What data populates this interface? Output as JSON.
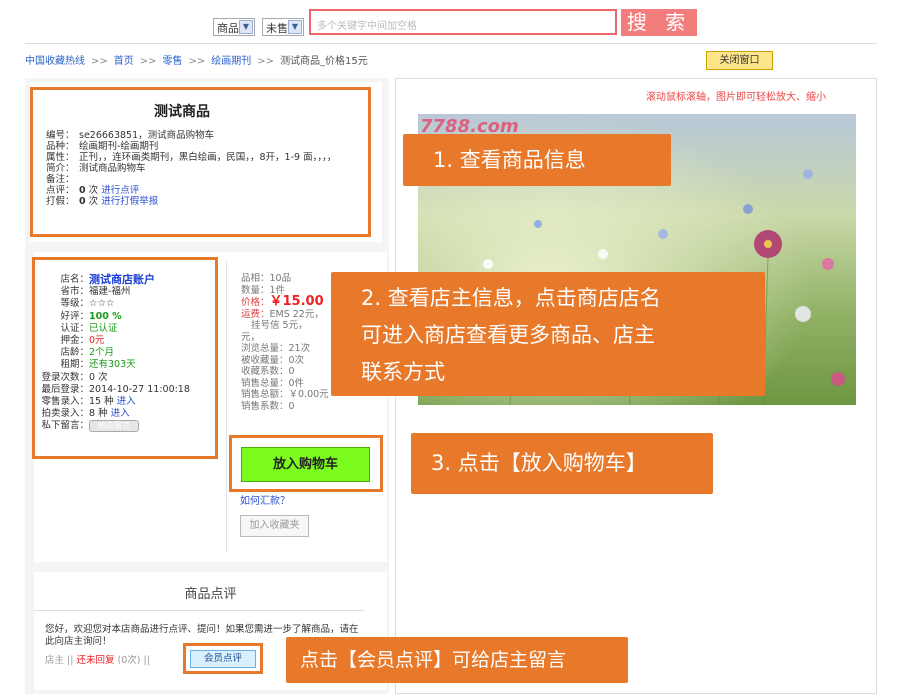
{
  "search": {
    "type_select": "商品",
    "status_select": "未售",
    "placeholder": "多个关键字中间加空格",
    "button_label": "搜 索"
  },
  "breadcrumb": {
    "items": [
      "中国收藏热线",
      "首页",
      "零售",
      "绘画期刊"
    ],
    "current": "测试商品_价格15元",
    "separator": ">>"
  },
  "close_window_label": "关闭窗口",
  "product": {
    "title": "测试商品",
    "rows": [
      {
        "key": "编号：",
        "value": "se26663851，测试商品购物车"
      },
      {
        "key": "品种：",
        "value": "绘画期刊-绘画期刊"
      },
      {
        "key": "属性：",
        "value": "正刊，，连环画类期刊，黑白绘画，民国，，8开，1-9 面，，，，"
      },
      {
        "key": "简介：",
        "value": "测试商品购物车"
      },
      {
        "key": "备注：",
        "value": ""
      }
    ],
    "review_count_label": "点评：",
    "review_count": "0",
    "review_unit": "次",
    "review_link": "进行点评",
    "fake_count_label": "打假：",
    "fake_count": "0",
    "fake_unit": "次",
    "fake_link": "进行打假举报"
  },
  "shop": {
    "name_key": "店名：",
    "name": "测试商店账户",
    "rows": [
      {
        "key": "省市：",
        "value": "福建-福州",
        "tone": "normal"
      },
      {
        "key": "等级：",
        "value": "☆☆☆",
        "tone": "normal"
      },
      {
        "key": "好评：",
        "value": "100 %",
        "tone": "green-bold"
      },
      {
        "key": "认证：",
        "value": "已认证",
        "tone": "green"
      },
      {
        "key": "押金：",
        "value": "0元",
        "tone": "red"
      },
      {
        "key": "店龄：",
        "value": "2个月",
        "tone": "green"
      },
      {
        "key": "租期：",
        "value": "还有303天",
        "tone": "green"
      },
      {
        "key": "登录次数：",
        "value": "0 次",
        "tone": "normal"
      },
      {
        "key": "最后登录：",
        "value": "2014-10-27 11:00:18",
        "tone": "normal"
      }
    ],
    "retail_key": "零售录入：",
    "retail_count": "15 种",
    "retail_link": "进入",
    "auction_key": "拍卖录入：",
    "auction_count": "8 种",
    "auction_link": "进入",
    "msg_key": "私下留言：",
    "msg_button": "给店留言"
  },
  "stats": {
    "rows_top": [
      {
        "key": "品相：",
        "value": "10品"
      },
      {
        "key": "数量：",
        "value": "1件"
      }
    ],
    "price_key": "价格：",
    "price": "￥15.00",
    "shipping_key": "运费：",
    "shipping_lines": [
      "EMS 22元，",
      "挂号信 5元，",
      "元，"
    ],
    "rows_bottom": [
      {
        "key": "浏览总量：",
        "value": "21次"
      },
      {
        "key": "被收藏量：",
        "value": "0次"
      },
      {
        "key": "收藏系数：",
        "value": "0"
      },
      {
        "key": "销售总量：",
        "value": "0件"
      },
      {
        "key": "销售总额：",
        "value": "￥0.00元"
      },
      {
        "key": "销售系数：",
        "value": "0"
      }
    ]
  },
  "cart_button": "放入购物车",
  "how_to_pay": "如何汇款？",
  "add_favorite": "加入收藏夹",
  "review": {
    "title": "商品点评",
    "text": "您好，欢迎您对本店商品进行点评、提问！如果您需进一步了解商品，请在此向店主询问！",
    "owner": "店主",
    "sep": "||",
    "no_reply": "还未回复",
    "count": "(0次)",
    "member_button": "会员点评"
  },
  "zoom_hint": "滚动鼠标滚轴，图片即可轻松放大、缩小",
  "photo_watermark": "7788.com",
  "callouts": {
    "c1": "1. 查看商品信息",
    "c2_lines": [
      "2. 查看店主信息，点击商店店名",
      "可进入商店查看更多商品、店主",
      "联系方式"
    ],
    "c3": "3. 点击【放入购物车】",
    "c4": "点击【会员点评】可给店主留言"
  },
  "colors": {
    "callout": "#e8782a",
    "cart_button": "#7cfb1e",
    "search_button": "#f37c7c",
    "link": "#2a4fd0"
  }
}
